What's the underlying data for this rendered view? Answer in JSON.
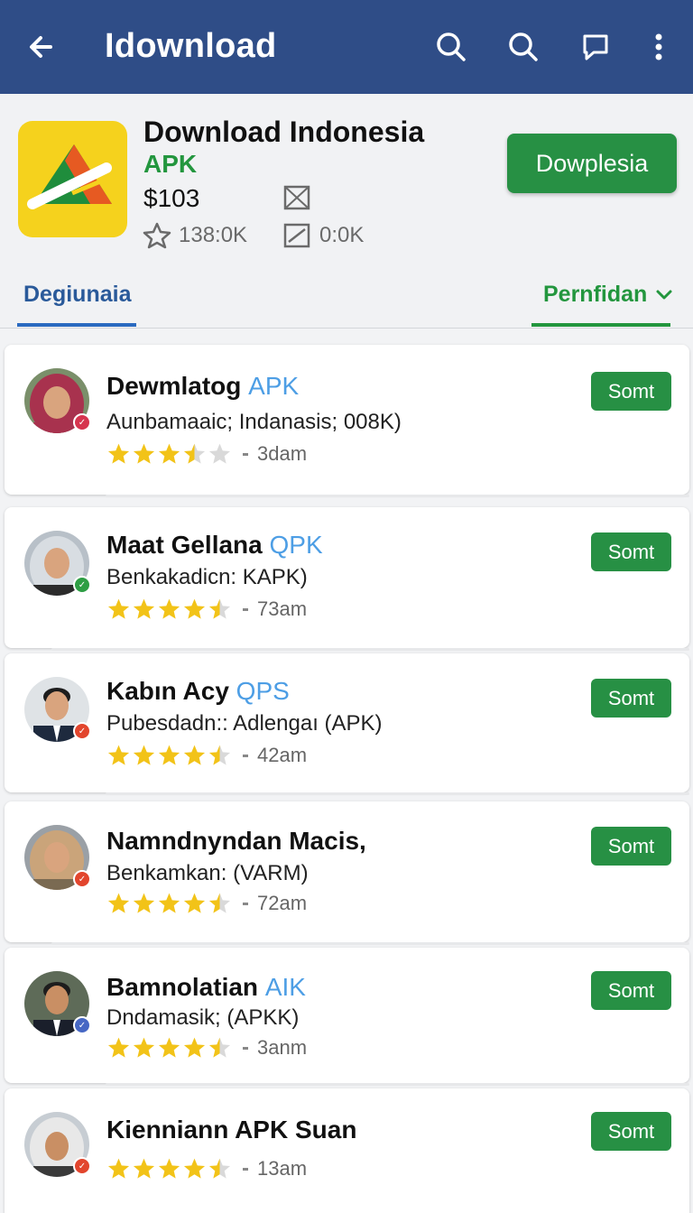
{
  "appbar": {
    "title": "Idownload",
    "colors": {
      "bar": "#2f4d87"
    }
  },
  "app": {
    "name": "Download Indonesia",
    "subtitle": "APK",
    "price": "$103",
    "rating_count": "138:0K",
    "downloads": "0:0K",
    "install_label": "Dowplesia"
  },
  "tabs": {
    "left": "Degiunaia",
    "right": "Pernfidan"
  },
  "items": [
    {
      "name": "Dewmlatog",
      "tag": "APK",
      "desc": "Aunbamaaic; Indanasis; 008K)",
      "rating": 3.5,
      "time": "3dam",
      "button": "Somt",
      "badge": "#d6344e"
    },
    {
      "name": "Maat Gellana",
      "tag": "QPK",
      "desc": "Benkakadicn: KAPK)",
      "rating": 4.5,
      "time": "73am",
      "button": "Somt",
      "badge": "#2e9e44"
    },
    {
      "name": "Kabın Acy",
      "tag": "QPS",
      "desc": "Pubesdadn:: Adlengaı (APK)",
      "rating": 4.5,
      "time": "42am",
      "button": "Somt",
      "badge": "#e2452d"
    },
    {
      "name": "Namndnyndan Macis,",
      "tag": "",
      "desc": "Benkamkan: (VARM)",
      "rating": 4.5,
      "time": "72am",
      "button": "Somt",
      "badge": "#e2452d"
    },
    {
      "name": "Bamnolatian",
      "tag": "AIK",
      "desc": "Dndamasik; (APKK)",
      "rating": 4.5,
      "time": "3anm",
      "button": "Somt",
      "badge": "#4667c4"
    },
    {
      "name": "Kienniann APK Suan",
      "tag": "",
      "desc": "",
      "rating": 4.5,
      "time": "13am",
      "button": "Somt",
      "badge": "#e2452d"
    }
  ]
}
